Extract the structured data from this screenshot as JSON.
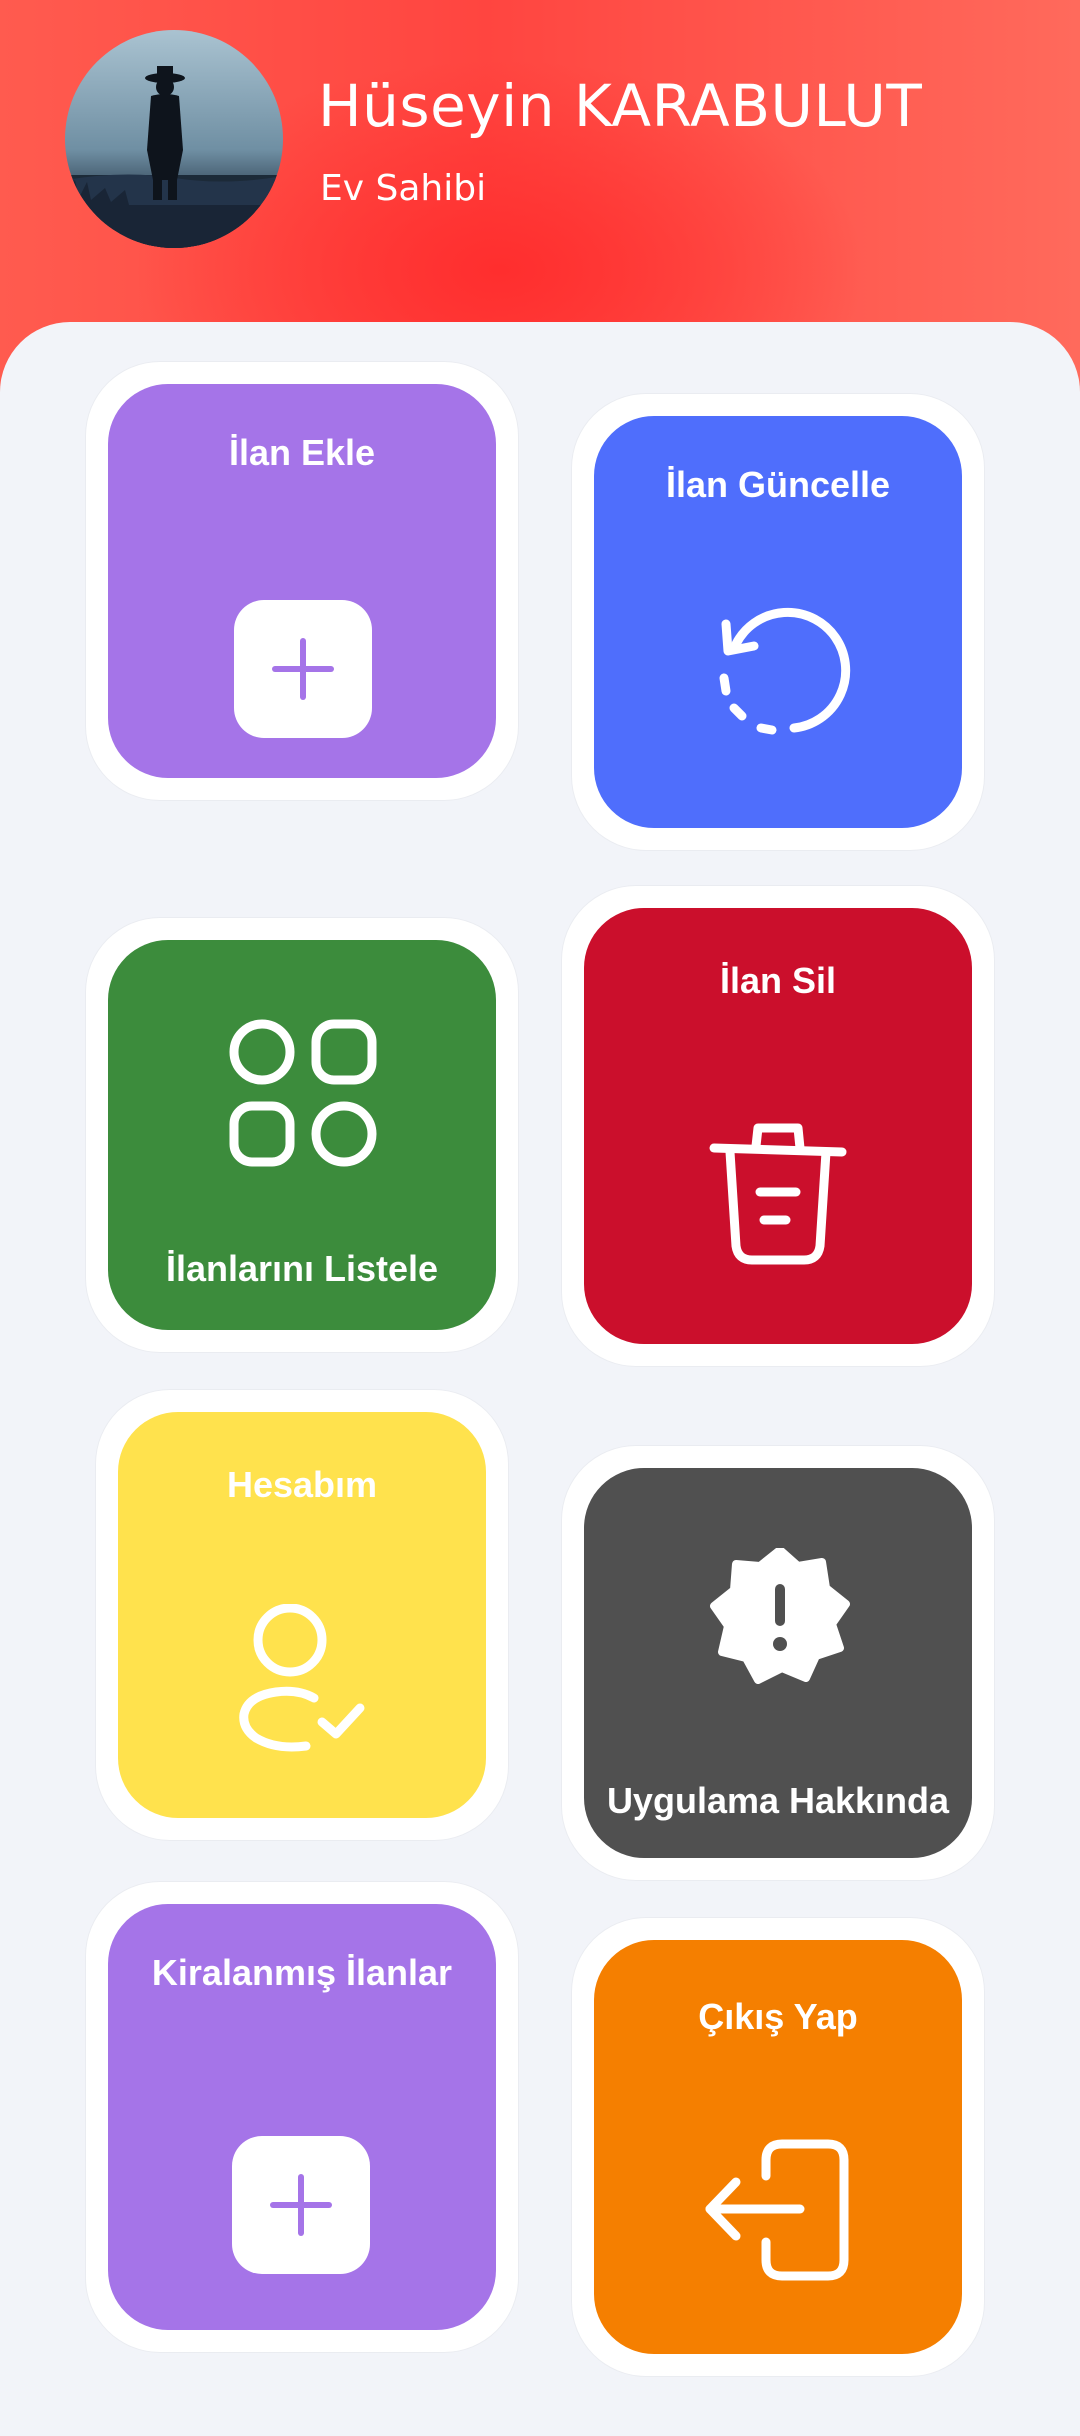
{
  "profile": {
    "name": "Hüseyin KARABULUT",
    "role": "Ev Sahibi"
  },
  "cards": [
    {
      "id": "ilan-ekle",
      "label": "İlan Ekle",
      "color": "#a574e8",
      "icon": "plus-square-icon"
    },
    {
      "id": "ilan-guncelle",
      "label": "İlan Güncelle",
      "color": "#4f6efc",
      "icon": "refresh-dashed-icon"
    },
    {
      "id": "ilanlarini-listele",
      "label": "İlanlarını Listele",
      "color": "#3c8c3c",
      "icon": "grid-apps-icon"
    },
    {
      "id": "ilan-sil",
      "label": "İlan Sil",
      "color": "#cb0f2c",
      "icon": "trash-icon"
    },
    {
      "id": "hesabim",
      "label": "Hesabım",
      "color": "#ffe24d",
      "icon": "user-check-icon"
    },
    {
      "id": "uygulama-hakkinda",
      "label": "Uygulama Hakkında",
      "color": "#505050",
      "icon": "alert-badge-icon"
    },
    {
      "id": "kiralanmis-ilanlar",
      "label": "Kiralanmış İlanlar",
      "color": "#a574e8",
      "icon": "plus-square-icon"
    },
    {
      "id": "cikis-yap",
      "label": "Çıkış Yap",
      "color": "#f57f00",
      "icon": "logout-icon"
    }
  ]
}
